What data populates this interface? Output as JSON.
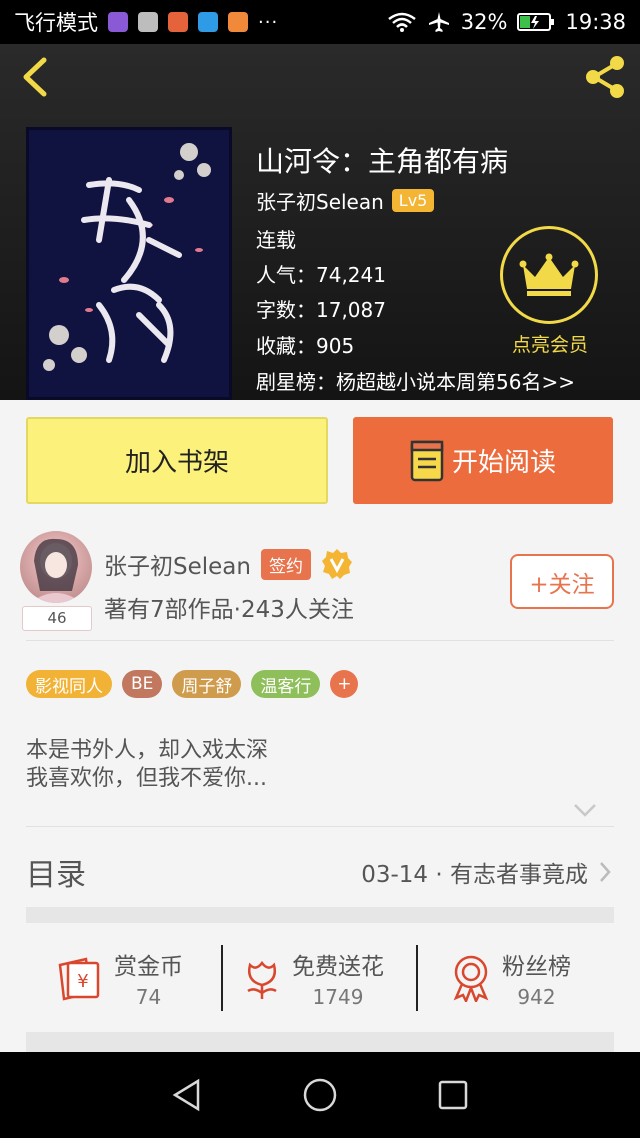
{
  "status_bar": {
    "airplane_mode_label": "飞行模式",
    "battery": "32%",
    "time": "19:38",
    "more": "···"
  },
  "book": {
    "title": "山河令：主角都有病",
    "author": "张子初Selean",
    "level": "Lv5",
    "status": "连载",
    "popularity": "人气：74,241",
    "word_count": "字数：17,087",
    "favorites": "收藏：905",
    "ranking": "剧星榜：杨超越小说本周第56名>>",
    "vip_label": "点亮会员"
  },
  "actions": {
    "add_shelf": "加入书架",
    "start_read": "开始阅读"
  },
  "author_card": {
    "name": "张子初Selean",
    "sign_badge": "签约",
    "avatar_count": "46",
    "stats": "著有7部作品·243人关注",
    "follow": "+关注"
  },
  "tags": [
    {
      "label": "影视同人",
      "color": "#f1b235"
    },
    {
      "label": "BE",
      "color": "#c2775f"
    },
    {
      "label": "周子舒",
      "color": "#cf9c4e"
    },
    {
      "label": "温客行",
      "color": "#8fbf5a"
    },
    {
      "label": "+",
      "color": "#e8744e"
    }
  ],
  "description": {
    "line1": "本是书外人，却入戏太深",
    "line2": "我喜欢你，但我不爱你..."
  },
  "toc": {
    "label": "目录",
    "latest": "03-14 · 有志者事竟成"
  },
  "stats": [
    {
      "label": "赏金币",
      "value": "74",
      "icon": "red-envelope-icon"
    },
    {
      "label": "免费送花",
      "value": "1749",
      "icon": "flower-icon"
    },
    {
      "label": "粉丝榜",
      "value": "942",
      "icon": "medal-icon"
    }
  ],
  "colors": {
    "accent_orange": "#ec6c3d",
    "shelf_yellow": "#fbf17b",
    "vip_gold": "#f2d948",
    "icon_red": "#d9482e"
  }
}
